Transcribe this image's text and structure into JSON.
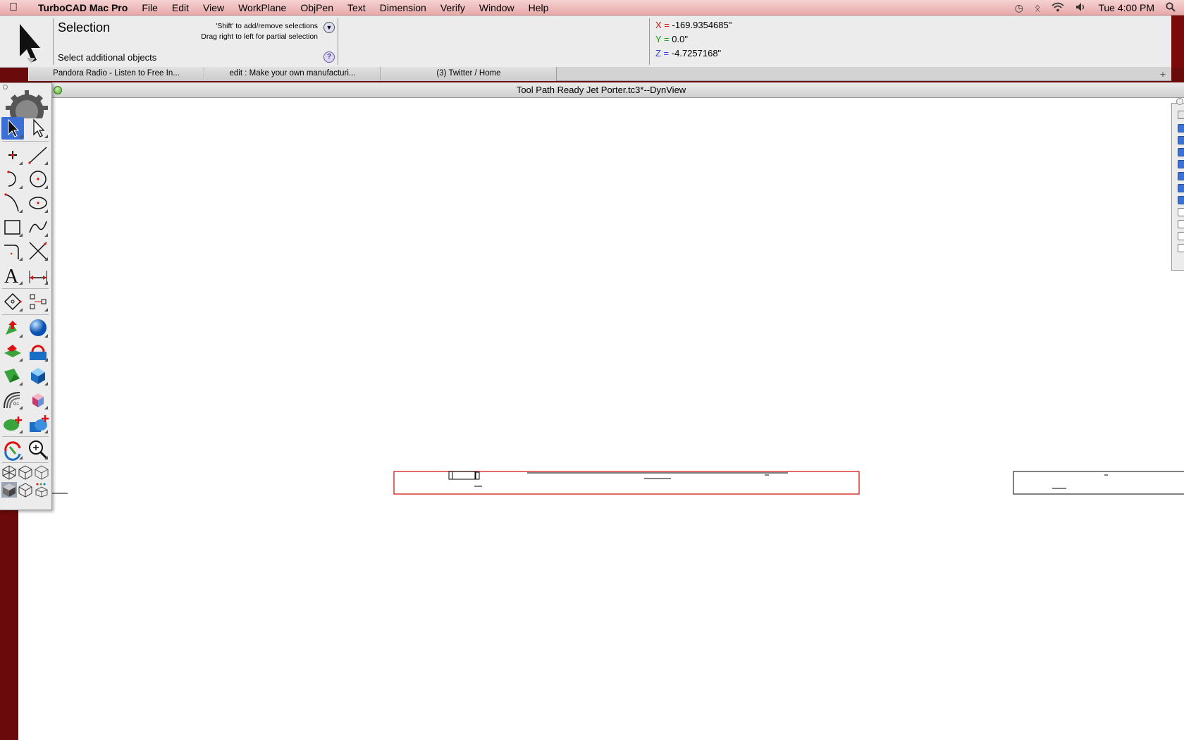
{
  "menubar": {
    "app_name": "TurboCAD Mac Pro",
    "menus": [
      "File",
      "Edit",
      "View",
      "WorkPlane",
      "ObjPen",
      "Text",
      "Dimension",
      "Verify",
      "Window",
      "Help"
    ],
    "clock": "Tue 4:00 PM"
  },
  "tool": {
    "title": "Selection",
    "hint_line1": "'Shift' to add/remove selections",
    "hint_line2": "Drag right to left for partial selection",
    "prompt": "Select additional objects",
    "help_glyph": "?"
  },
  "coords": {
    "x_label": "X =",
    "x_value": "-169.9354685\"",
    "y_label": "Y =",
    "y_value": "0.0\"",
    "z_label": "Z =",
    "z_value": "-4.7257168\""
  },
  "tabs": [
    {
      "label": "Pandora Radio - Listen to Free In..."
    },
    {
      "label": "edit : Make your own manufacturi..."
    },
    {
      "label": "(3) Twitter / Home"
    }
  ],
  "window": {
    "title": "Tool Path Ready Jet Porter.tc3*--DynView"
  },
  "colors": {
    "selection_red": "#d11a1a",
    "toolbar_select_blue": "#3b6fd6",
    "desktop_red": "#6b0a0a"
  },
  "icons": [
    "apple-icon",
    "time-machine-icon",
    "bluetooth-icon",
    "wifi-icon",
    "volume-icon",
    "spotlight-icon",
    "gear-icon"
  ]
}
